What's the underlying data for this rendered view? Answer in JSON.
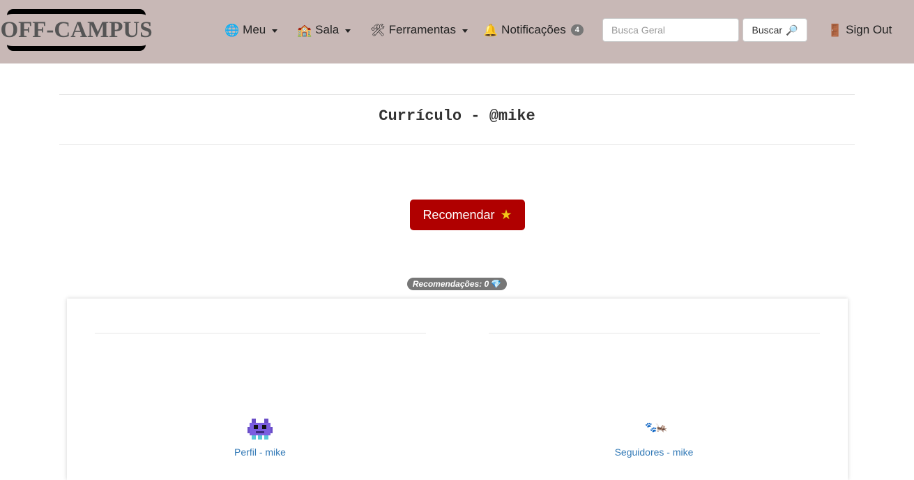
{
  "navbar": {
    "brand": "OFF-CAMPUS",
    "menu": [
      {
        "label": "Meu",
        "icon": "globe-icon"
      },
      {
        "label": "Sala",
        "icon": "school-icon"
      },
      {
        "label": "Ferramentas",
        "icon": "tools-icon"
      }
    ],
    "notifications": {
      "label": "Notificações",
      "count": "4",
      "icon": "bell-icon"
    },
    "search": {
      "placeholder": "Busca Geral",
      "value": "",
      "button_label": "Buscar"
    },
    "signout": {
      "label": "Sign Out",
      "icon": "door-icon"
    },
    "bg_color": "#c8b8b6"
  },
  "page": {
    "title": "Currículo - @mike",
    "recommend_button": "Recomendar",
    "recommendations_label": "Recomendações: 0",
    "accent_color": "#b00000"
  },
  "cards": {
    "profile_link": "Perfil - mike",
    "followers_link": "Seguidores - mike",
    "link_color": "#337ab7"
  }
}
